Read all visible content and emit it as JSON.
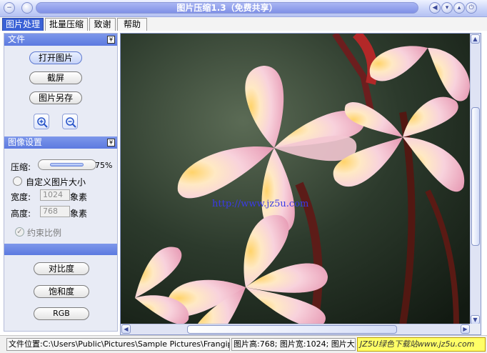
{
  "window": {
    "title": "图片压缩1.3（免费共享）"
  },
  "tabs": [
    {
      "label": "图片处理",
      "active": true
    },
    {
      "label": "批量压缩"
    },
    {
      "label": "致谢"
    },
    {
      "label": "帮助"
    }
  ],
  "sections": {
    "file": {
      "title": "文件",
      "open_label": "打开图片",
      "screenshot_label": "截屏",
      "save_as_label": "图片另存"
    },
    "image_settings": {
      "title": "图像设置",
      "compress_label": "压缩:",
      "compress_value": "75%",
      "compress_level": 0.75,
      "custom_size_label": "自定义图片大小",
      "width_label": "宽度:",
      "width_value": "1024",
      "width_unit": "象素",
      "height_label": "高度:",
      "height_value": "768",
      "height_unit": "象素",
      "constrain_label": "约束比例"
    },
    "adjust": {
      "contrast_label": "对比度",
      "saturation_label": "饱和度",
      "rgb_label": "RGB"
    }
  },
  "viewer": {
    "watermark": "http://www.jz5u.com"
  },
  "status": {
    "file_path": "文件位置:C:\\Users\\Public\\Pictures\\Sample Pictures\\Frangipani f",
    "dimensions": "图片高:768; 图片宽:1024; 图片大",
    "brand": "JZ5U绿色下载站www.jz5u.com"
  },
  "colors": {
    "accent": "#3b62d6",
    "section_header": "#6b86e4",
    "brand_bg": "#ffff66"
  }
}
